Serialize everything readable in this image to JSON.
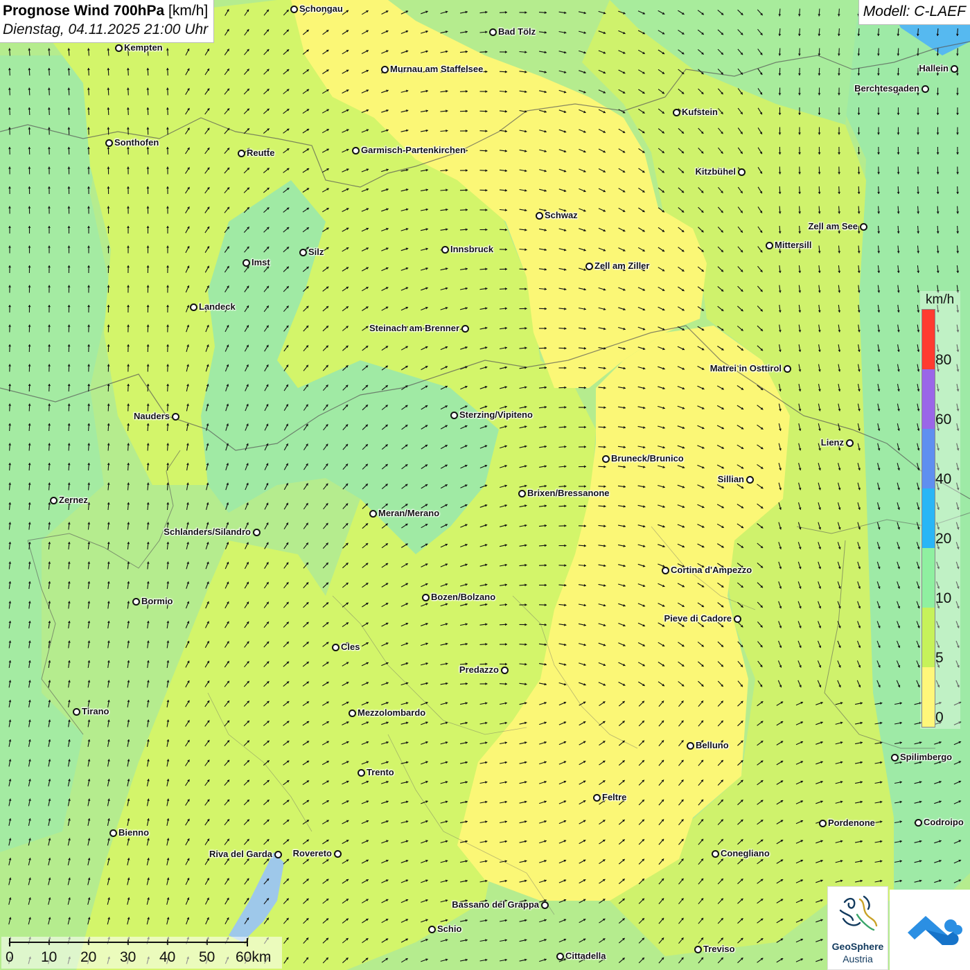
{
  "title": {
    "main_bold": "Prognose Wind 700hPa",
    "main_unit": "[km/h]",
    "datetime": "Dienstag, 04.11.2025 21:00 Uhr"
  },
  "model_label": "Modell: C-LAEF",
  "legend": {
    "unit": "km/h",
    "ticks": [
      "80",
      "60",
      "40",
      "20",
      "10",
      "5",
      "0"
    ],
    "colors": [
      "#ff3b30",
      "#9a66e8",
      "#5f8ff0",
      "#29b6f6",
      "#8ff0a0",
      "#c6f25a",
      "#fff77a"
    ]
  },
  "scale_bar": {
    "labels": [
      "0",
      "10",
      "20",
      "30",
      "40",
      "50",
      "60km"
    ]
  },
  "logos": {
    "geosphere_line1": "GeoSphere",
    "geosphere_line2": "Austria"
  },
  "colors": {
    "calm_yellow": "#fbf776",
    "light_green": "#d3f56a",
    "green": "#b5ec8e",
    "mint": "#9eeaa6",
    "water_blue": "#56b9f0",
    "arrow": "#111111"
  },
  "cities": [
    {
      "name": "Schongau"
    },
    {
      "name": "Kempten"
    },
    {
      "name": "Bad Tölz"
    },
    {
      "name": "Murnau am Staffelsee"
    },
    {
      "name": "Hallein"
    },
    {
      "name": "Berchtesgaden"
    },
    {
      "name": "Kufstein"
    },
    {
      "name": "Sonthofen"
    },
    {
      "name": "Reutte"
    },
    {
      "name": "Garmisch-Partenkirchen"
    },
    {
      "name": "Kitzbühel"
    },
    {
      "name": "Schwaz"
    },
    {
      "name": "Zell am See"
    },
    {
      "name": "Mittersill"
    },
    {
      "name": "Silz"
    },
    {
      "name": "Innsbruck"
    },
    {
      "name": "Imst"
    },
    {
      "name": "Zell am Ziller"
    },
    {
      "name": "Landeck"
    },
    {
      "name": "Steinach am Brenner"
    },
    {
      "name": "Matrei in Osttirol"
    },
    {
      "name": "Nauders"
    },
    {
      "name": "Sterzing/Vipiteno"
    },
    {
      "name": "Lienz"
    },
    {
      "name": "Bruneck/Brunico"
    },
    {
      "name": "Sillian"
    },
    {
      "name": "Brixen/Bressanone"
    },
    {
      "name": "Zernez"
    },
    {
      "name": "Meran/Merano"
    },
    {
      "name": "Schlanders/Silandro"
    },
    {
      "name": "Cortina d'Ampezzo"
    },
    {
      "name": "Bozen/Bolzano"
    },
    {
      "name": "Bormio"
    },
    {
      "name": "Pieve di Cadore"
    },
    {
      "name": "Cles"
    },
    {
      "name": "Predazzo"
    },
    {
      "name": "Tirano"
    },
    {
      "name": "Mezzolombardo"
    },
    {
      "name": "Belluno"
    },
    {
      "name": "Spilimbergo"
    },
    {
      "name": "Trento"
    },
    {
      "name": "Feltre"
    },
    {
      "name": "Pordenone"
    },
    {
      "name": "Codroipo"
    },
    {
      "name": "Bienno"
    },
    {
      "name": "Riva del Garda"
    },
    {
      "name": "Rovereto"
    },
    {
      "name": "Conegliano"
    },
    {
      "name": "Bassano del Grappa"
    },
    {
      "name": "Schio"
    },
    {
      "name": "Treviso"
    },
    {
      "name": "Cittadella"
    }
  ]
}
